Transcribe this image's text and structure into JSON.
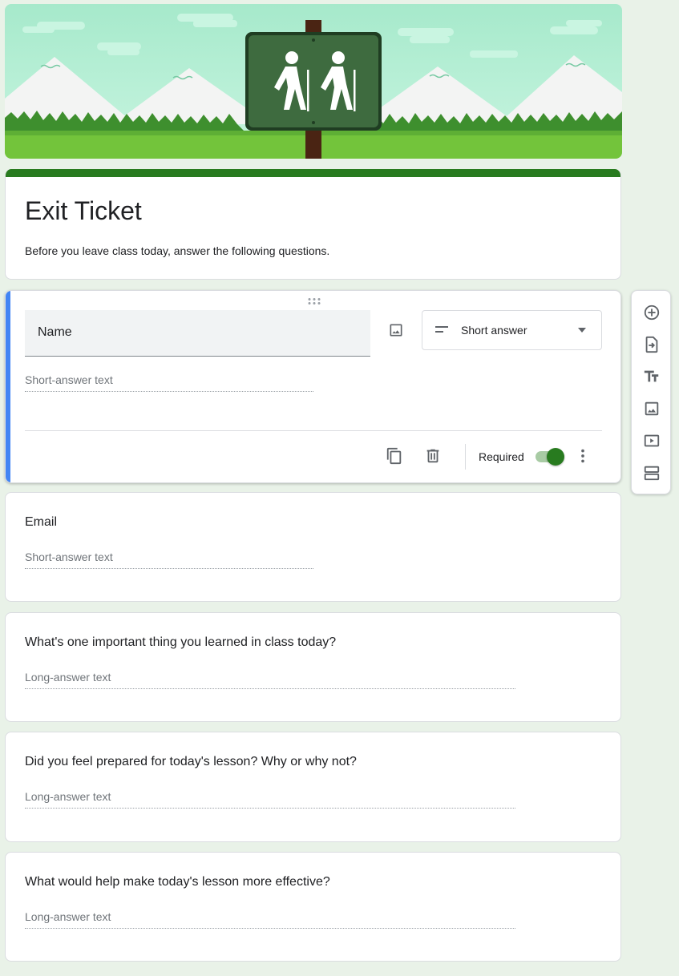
{
  "theme": {
    "accent": "#287b1f",
    "active_bar": "#4285f4",
    "background": "#e9f2e8"
  },
  "header": {
    "banner_icon": "hiking-trail-sign"
  },
  "form": {
    "title": "Exit Ticket",
    "description": "Before you leave class today, answer the following questions."
  },
  "active_question": {
    "title": "Name",
    "type_label": "Short answer",
    "type_icon": "short-text-icon",
    "answer_placeholder": "Short-answer text",
    "required_label": "Required",
    "required": true
  },
  "questions": [
    {
      "title": "Email",
      "answer_placeholder": "Short-answer text"
    },
    {
      "title": "What's one important thing you learned in class today?",
      "answer_placeholder": "Long-answer text"
    },
    {
      "title": "Did you feel prepared for today's lesson? Why or why not?",
      "answer_placeholder": "Long-answer text"
    },
    {
      "title": "What would help make today's lesson more effective?",
      "answer_placeholder": "Long-answer text"
    }
  ],
  "toolbar": {
    "tools": [
      "add-question-icon",
      "import-questions-icon",
      "add-title-icon",
      "add-image-icon",
      "add-video-icon",
      "add-section-icon"
    ]
  }
}
